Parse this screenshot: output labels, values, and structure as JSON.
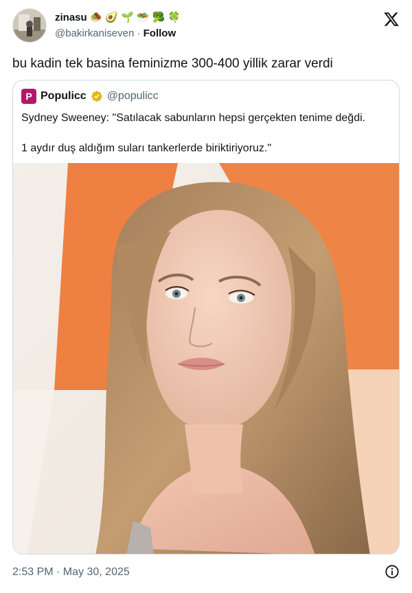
{
  "author": {
    "display_name": "zinasu",
    "emojis": [
      "🧆",
      "🥑",
      "🌱",
      "🥗",
      "🥦",
      "🍀"
    ],
    "handle": "@bakirkaniseven",
    "separator": "·",
    "follow_label": "Follow"
  },
  "tweet": {
    "text": "bu kadin tek basina feminizme 300-400 yillik zarar verdi"
  },
  "quote": {
    "avatar_letter": "P",
    "name": "Populicc",
    "handle": "@populicc",
    "line1": "Sydney Sweeney: \"Satılacak sabunların hepsi gerçekten tenime değdi.",
    "line2": "1 aydır duş aldığım suları tankerlerde biriktiriyoruz.\""
  },
  "footer": {
    "timestamp": "2:53 PM · May 30, 2025"
  },
  "icons": {
    "brand": "x-logo-icon",
    "verified": "verified-badge-icon",
    "info": "info-icon"
  },
  "colors": {
    "text": "#0f1419",
    "secondary": "#536471",
    "border": "#cfd9de",
    "verified_gold": "#e2b719",
    "populicc_brand": "#b2186b"
  }
}
